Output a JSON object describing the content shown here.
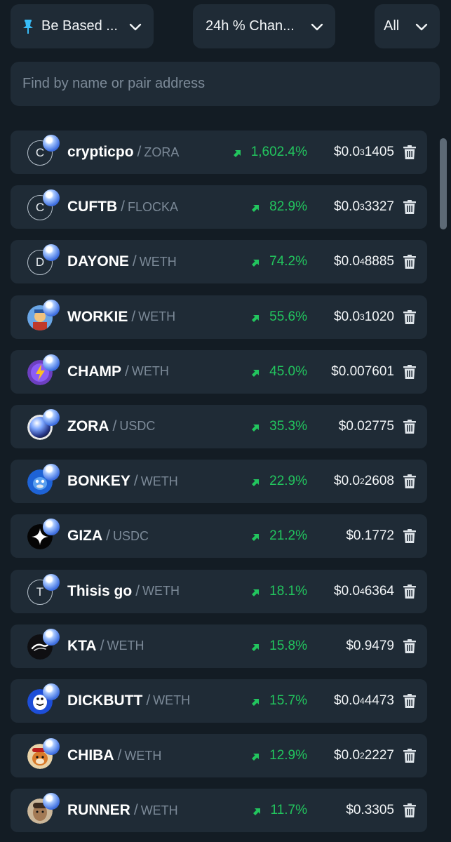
{
  "filters": {
    "pinned_filter": {
      "label": "Be Based ...",
      "icon": "pin-icon"
    },
    "change_filter": {
      "label": "24h % Chan..."
    },
    "scope_filter": {
      "label": "All"
    }
  },
  "search": {
    "placeholder": "Find by name or pair address",
    "value": ""
  },
  "colors": {
    "background": "#131c24",
    "card": "#1f2b36",
    "positive": "#22c55e",
    "muted": "#7c8a98"
  },
  "tokens": [
    {
      "name": "crypticpo",
      "pair": "ZORA",
      "change": "1,602.4%",
      "price_prefix": "$0.0",
      "price_sub": "3",
      "price_rest": "1405",
      "avatar": "letter",
      "letter": "C"
    },
    {
      "name": "CUFTB",
      "pair": "FLOCKA",
      "change": "82.9%",
      "price_prefix": "$0.0",
      "price_sub": "3",
      "price_rest": "3327",
      "avatar": "letter",
      "letter": "C"
    },
    {
      "name": "DAYONE",
      "pair": "WETH",
      "change": "74.2%",
      "price_prefix": "$0.0",
      "price_sub": "4",
      "price_rest": "8885",
      "avatar": "letter",
      "letter": "D"
    },
    {
      "name": "WORKIE",
      "pair": "WETH",
      "change": "55.6%",
      "price_prefix": "$0.0",
      "price_sub": "3",
      "price_rest": "1020",
      "avatar": "workie-logo"
    },
    {
      "name": "CHAMP",
      "pair": "WETH",
      "change": "45.0%",
      "price_prefix": "$0.007601",
      "price_sub": "",
      "price_rest": "",
      "avatar": "champ-logo"
    },
    {
      "name": "ZORA",
      "pair": "USDC",
      "change": "35.3%",
      "price_prefix": "$0.02775",
      "price_sub": "",
      "price_rest": "",
      "avatar": "zora-logo"
    },
    {
      "name": "BONKEY",
      "pair": "WETH",
      "change": "22.9%",
      "price_prefix": "$0.0",
      "price_sub": "2",
      "price_rest": "2608",
      "avatar": "bonkey-logo"
    },
    {
      "name": "GIZA",
      "pair": "USDC",
      "change": "21.2%",
      "price_prefix": "$0.1772",
      "price_sub": "",
      "price_rest": "",
      "avatar": "giza-logo"
    },
    {
      "name": "Thisis go",
      "pair": "WETH",
      "change": "18.1%",
      "price_prefix": "$0.0",
      "price_sub": "4",
      "price_rest": "6364",
      "avatar": "letter",
      "letter": "T"
    },
    {
      "name": "KTA",
      "pair": "WETH",
      "change": "15.8%",
      "price_prefix": "$0.9479",
      "price_sub": "",
      "price_rest": "",
      "avatar": "kta-logo"
    },
    {
      "name": "DICKBUTT",
      "pair": "WETH",
      "change": "15.7%",
      "price_prefix": "$0.0",
      "price_sub": "4",
      "price_rest": "4473",
      "avatar": "dickbutt-logo"
    },
    {
      "name": "CHIBA",
      "pair": "WETH",
      "change": "12.9%",
      "price_prefix": "$0.0",
      "price_sub": "2",
      "price_rest": "2227",
      "avatar": "chiba-logo"
    },
    {
      "name": "RUNNER",
      "pair": "WETH",
      "change": "11.7%",
      "price_prefix": "$0.3305",
      "price_sub": "",
      "price_rest": "",
      "avatar": "runner-logo"
    }
  ]
}
